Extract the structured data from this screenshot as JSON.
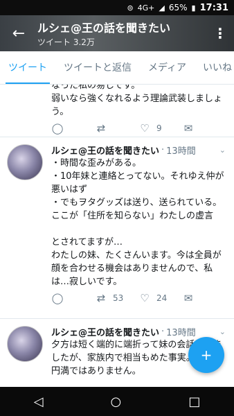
{
  "status_bar": {
    "icons": [
      "settings-icon",
      "signal-4g-icon",
      "signal-icon",
      "battery-icon"
    ],
    "network": "4G+",
    "battery": "65%",
    "time": "17:31"
  },
  "header": {
    "title": "ルシェ@王の話を聞きたい",
    "subtitle": "ツイート 3.2万"
  },
  "tabs": [
    {
      "label": "ツイート",
      "active": true
    },
    {
      "label": "ツイートと返信",
      "active": false
    },
    {
      "label": "メディア",
      "active": false
    },
    {
      "label": "いいね",
      "active": false
    }
  ],
  "tweets": [
    {
      "name": "",
      "time": "",
      "text": "なった私の易しです。\n弱いなら強くなれるよう理論武装しましょう。",
      "replies": "",
      "retweets": "",
      "likes": "9"
    },
    {
      "name": "ルシェ@王の話を聞きたい",
      "time": "13時間",
      "text": "・時間な歪みがある。\n・10年妹と連絡とってない。それゆえ仲が悪いはず\n・でもヲタグッズは送り、送られている。ここが「住所を知らない」わたしの虚言\n\nとされてますが…\nわたしの妹、たくさんいます。今は全員が顔を合わせる機会はありませんので、私は…寂しいです。",
      "replies": "",
      "retweets": "53",
      "likes": "24"
    },
    {
      "name": "ルシェ@王の話を聞きたい",
      "time": "13時間",
      "text": "夕方は短く端的に端折って妹の会話をきましたが、家族内で相当もめた事実。全てが円満ではありません。",
      "replies": "",
      "retweets": "",
      "likes": ""
    }
  ],
  "fab_label": "+",
  "nav": [
    "back-triangle-icon",
    "home-circle-icon",
    "recents-square-icon"
  ]
}
